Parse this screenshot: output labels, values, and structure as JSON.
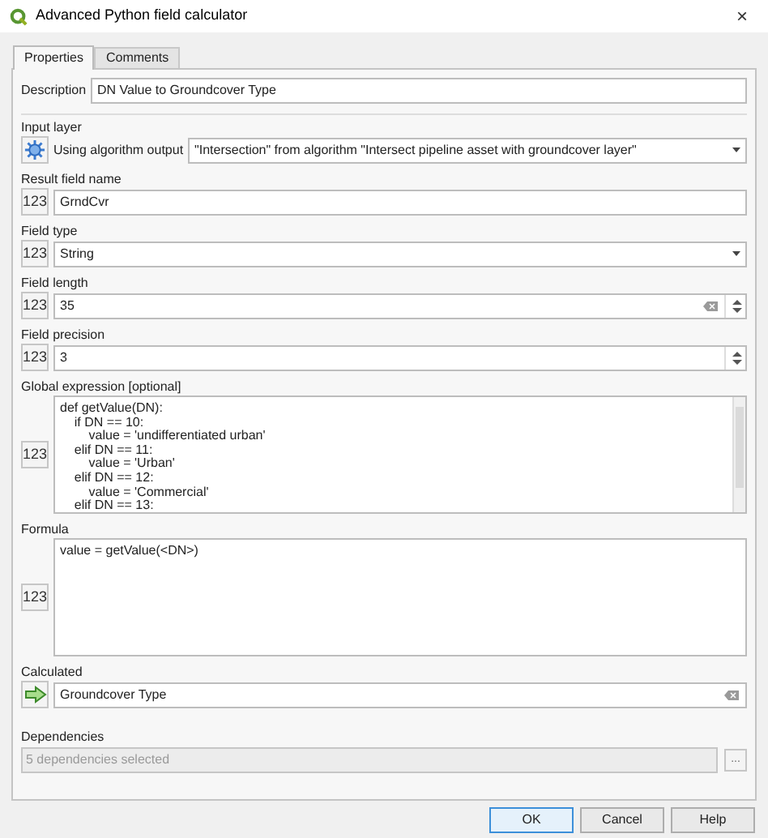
{
  "window": {
    "title": "Advanced Python field calculator",
    "close": "×"
  },
  "tabs": [
    {
      "label": "Properties",
      "selected": true
    },
    {
      "label": "Comments",
      "selected": false
    }
  ],
  "description": {
    "label": "Description",
    "value": "DN Value to Groundcover Type"
  },
  "sections": [
    {
      "kind": "combo",
      "label": "Input layer",
      "button": {
        "kind": "gear"
      },
      "prefix": "Using algorithm output",
      "value": "\"Intersection\" from algorithm \"Intersect pipeline asset with groundcover layer\""
    },
    {
      "kind": "text",
      "label": "Result field name",
      "button": {
        "kind": "text",
        "text": "123"
      },
      "value": "GrndCvr",
      "clearable": false
    },
    {
      "kind": "combo",
      "label": "Field type",
      "button": {
        "kind": "text",
        "text": "123"
      },
      "value": "String"
    },
    {
      "kind": "spin",
      "label": "Field length",
      "button": {
        "kind": "text",
        "text": "123"
      },
      "value": "35",
      "clearable": true
    },
    {
      "kind": "spin",
      "label": "Field precision",
      "button": {
        "kind": "text",
        "text": "123"
      },
      "value": "3",
      "clearable": false
    },
    {
      "kind": "code",
      "label": "Global expression [optional]",
      "button": {
        "kind": "text",
        "text": "123"
      },
      "lines": [
        "def getValue(DN):",
        "    if DN == 10:",
        "        value = 'undifferentiated urban'",
        "    elif DN == 11:",
        "        value = 'Urban'",
        "    elif DN == 12:",
        "        value = 'Commercial'",
        "    elif DN == 13:"
      ],
      "scrollbar": true
    },
    {
      "kind": "code",
      "label": "Formula",
      "button": {
        "kind": "text",
        "text": "123"
      },
      "lines": [
        "value = getValue(<DN>)"
      ],
      "scrollbar": false
    },
    {
      "kind": "text",
      "label": "Calculated",
      "button": {
        "kind": "arrow"
      },
      "value": "Groundcover Type",
      "clearable": true
    }
  ],
  "dependencies": {
    "label": "Dependencies",
    "value": "5 dependencies selected",
    "disabled": true,
    "browse": "..."
  },
  "buttons": [
    {
      "label": "OK",
      "default": true
    },
    {
      "label": "Cancel",
      "default": false
    },
    {
      "label": "Help",
      "default": false
    }
  ]
}
